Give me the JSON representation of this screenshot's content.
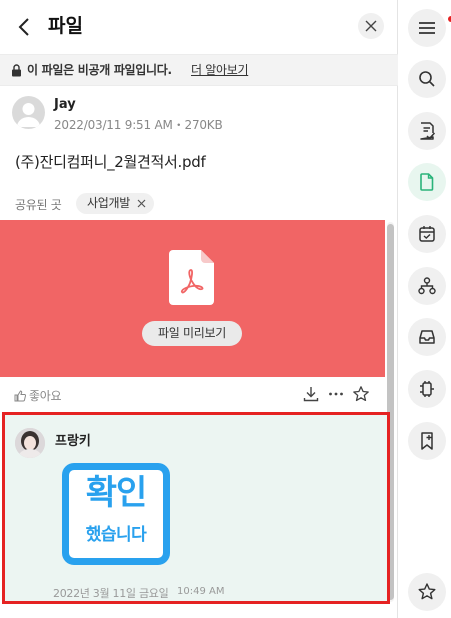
{
  "header": {
    "title": "파일"
  },
  "notice": {
    "text": "이 파일은 비공개 파일입니다.",
    "link": "더 알아보기"
  },
  "file": {
    "author": "Jay",
    "meta": "2022/03/11 9:51 AM・270KB",
    "name": "(주)잔디컴퍼니_2월견적서.pdf"
  },
  "shared": {
    "label": "공유된 곳",
    "chip": "사업개발"
  },
  "preview": {
    "button": "파일 미리보기"
  },
  "actions": {
    "like": "좋아요"
  },
  "comment": {
    "author": "프랑키",
    "sticker_line1": "확인",
    "sticker_line2": "했습니다",
    "date": "2022년 3월 11일 금요일",
    "time": "10:49 AM"
  },
  "rail": {
    "items": [
      "menu-icon",
      "search-icon",
      "note-check-icon",
      "file-icon",
      "calendar-check-icon",
      "org-chart-icon",
      "inbox-icon",
      "connector-icon",
      "bookmark-add-icon",
      "star-icon"
    ]
  },
  "colors": {
    "preview_bg": "#f16565",
    "comment_bg": "#ecf5f2",
    "highlight_border": "#e52222",
    "sticker_blue": "#29a1ee",
    "active_green": "#2ab37a"
  }
}
